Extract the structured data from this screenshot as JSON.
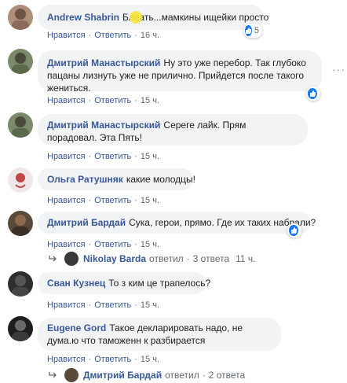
{
  "actions": {
    "like": "Нравится",
    "reply": "Ответить",
    "dot": "·"
  },
  "colors": {
    "name": "#385898",
    "bubble": "#f2f3f5",
    "like": "#1877f2"
  },
  "comments": [
    {
      "author": "Andrew Shabrin",
      "text": "Блеать...мамкины ищейки просто",
      "time": "16 ч.",
      "reactions": "5"
    },
    {
      "author": "Дмитрий Манастырский",
      "text": "Ну это уже перебор. Так глубоко пацаны лизнуть уже не прилично. Прийдется после такого жениться.",
      "time": "15 ч.",
      "reactions": ""
    },
    {
      "author": "Дмитрий Манастырский",
      "text": "Сереге лайк. Прям порадовал. Эта Пять!",
      "time": "15 ч.",
      "reactions": ""
    },
    {
      "author": "Ольга Ратушняк",
      "text": "какие молодцы!",
      "time": "15 ч.",
      "reactions": ""
    },
    {
      "author": "Дмитрий Бардай",
      "text": "Сука, герои, прямо. Где их таких набрали?",
      "time": "15 ч.",
      "reactions": ""
    },
    {
      "author": "Сван Кузнец",
      "text": "То з ким це трапелось?",
      "time": "15 ч.",
      "reactions": ""
    },
    {
      "author": "Eugene Gord",
      "text": "Такое декларировать надо, не дума.ю что таможенн к разбирается",
      "time": "15 ч.",
      "reactions": ""
    }
  ],
  "replies": [
    {
      "name": "Nikolay Barda",
      "label": "ответил",
      "count": "3 ответа",
      "time": "11 ч."
    },
    {
      "name": "Дмитрий Бардай",
      "label": "ответил",
      "count": "2 ответа",
      "time": ""
    }
  ],
  "icons": {
    "more": "more-dots-icon",
    "like": "like-thumb-icon",
    "reply_arrow": "reply-arrow-icon"
  }
}
